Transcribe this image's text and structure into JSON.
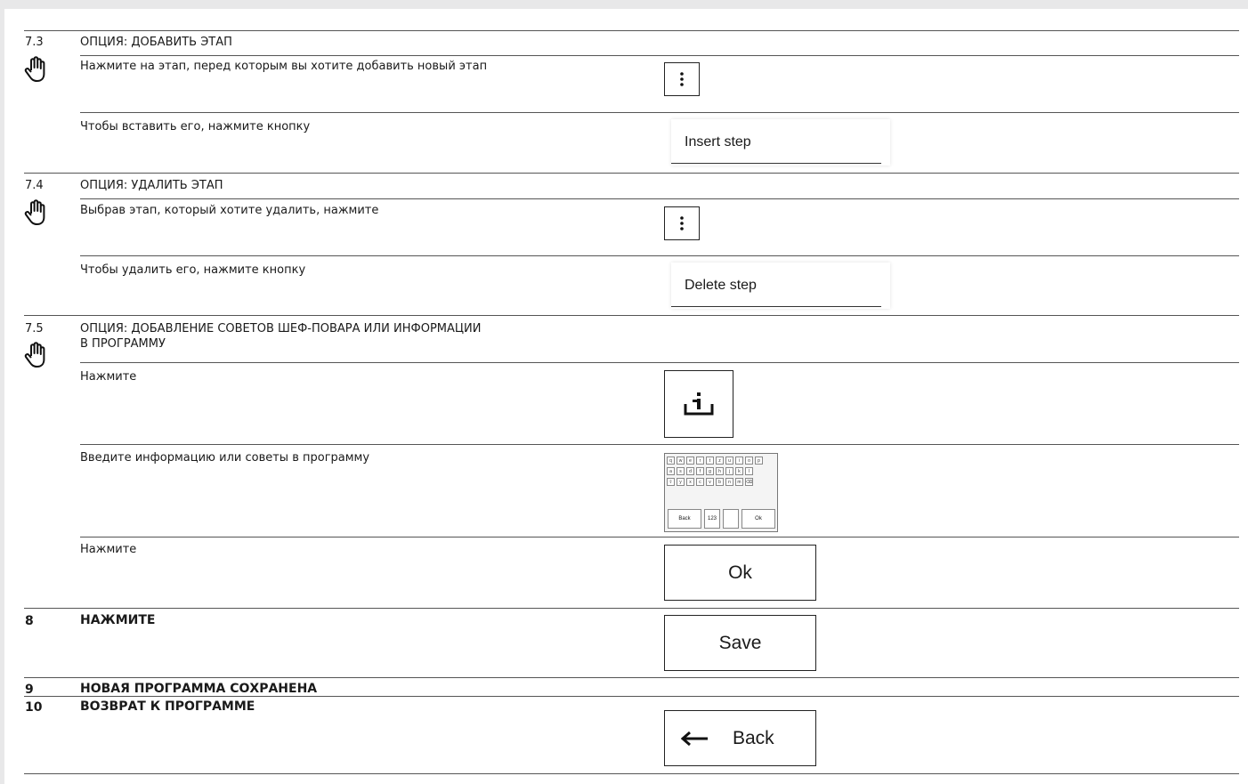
{
  "sections": {
    "s73": {
      "number": "7.3",
      "title": "ОПЦИЯ: ДОБАВИТЬ ЭТАП",
      "row1_text": "Нажмите на этап, перед которым вы хотите добавить новый этап",
      "row2_text": "Чтобы вставить его, нажмите кнопку",
      "button_label": "Insert step"
    },
    "s74": {
      "number": "7.4",
      "title": "ОПЦИЯ: УДАЛИТЬ ЭТАП",
      "row1_text": "Выбрав этап, который хотите удалить, нажмите",
      "row2_text": "Чтобы удалить его, нажмите кнопку",
      "button_label": "Delete step"
    },
    "s75": {
      "number": "7.5",
      "title_line1": "ОПЦИЯ: ДОБАВЛЕНИЕ СОВЕТОВ ШЕФ-ПОВАРА ИЛИ ИНФОРМАЦИИ",
      "title_line2": "В ПРОГРАММУ",
      "row1_text": "Нажмите",
      "row2_text": "Введите информацию или советы в программу",
      "row3_text": "Нажмите",
      "ok_label": "Ok"
    },
    "s8": {
      "number": "8",
      "title": "НАЖМИТЕ",
      "button_label": "Save"
    },
    "s9": {
      "number": "9",
      "title": "НОВАЯ ПРОГРАММА СОХРАНЕНА"
    },
    "s10": {
      "number": "10",
      "title": "ВОЗВРАТ К ПРОГРАММЕ",
      "button_label": "Back"
    }
  },
  "keyboard": {
    "row1": [
      "q",
      "w",
      "e",
      "r",
      "t",
      "z",
      "u",
      "i",
      "o",
      "p"
    ],
    "row2": [
      "a",
      "s",
      "d",
      "f",
      "g",
      "h",
      "j",
      "k",
      "l"
    ],
    "row3": [
      "⇧",
      "y",
      "x",
      "c",
      "v",
      "b",
      "n",
      "m",
      "⌫"
    ],
    "back": "Back",
    "num": "123",
    "ok": "Ok"
  },
  "icons": {
    "hand": "hand-pointer-icon",
    "more": "vertical-dots-icon",
    "info": "info-tray-icon",
    "back_arrow": "left-arrow-icon"
  }
}
